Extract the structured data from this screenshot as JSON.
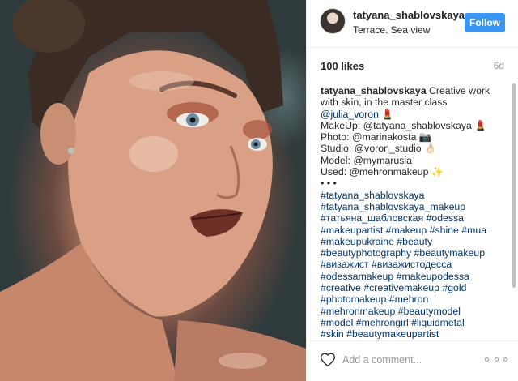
{
  "post": {
    "username": "tatyana_shablovskaya",
    "location": "Terrace. Sea view",
    "follow_label": "Follow",
    "likes": "100 likes",
    "age": "6d"
  },
  "caption": {
    "author": "tatyana_shablovskaya",
    "lines": [
      " Creative work",
      "with skin, in the master class",
      "@julia_voron 💄",
      "MakeUp: @tatyana_shablovskaya 💄",
      "Photo: @marinakosta 📷",
      "Studio: @voron_studio 👌🏻",
      "Model: @mymarusia",
      "Used: @mehronmakeup ✨",
      "• • •",
      "#tatyana_shablovskaya",
      "#tatyana_shablovskaya_makeup",
      "#татьяна_шабловская #odessa",
      "#makeupartist #makeup #shine #mua",
      "#makeupukraine #beauty",
      "#beautyphotography #beautymakeup",
      "#визажист #визажистодесса",
      "#odessamakeup #makeupodessa",
      "#creative #creativemakeup #gold",
      "#photomakeup #mehron",
      "#mehronmakeup #beautymodel",
      "#model #mehrongirl #liquidmetal",
      "#skin #beautymakeupartist"
    ]
  },
  "comment": {
    "placeholder": "Add a comment..."
  },
  "icons": {
    "like": "heart-icon",
    "more": "more-options-icon"
  },
  "colors": {
    "accent": "#3897f0",
    "link": "#003569",
    "text": "#262626",
    "muted": "#999999"
  }
}
